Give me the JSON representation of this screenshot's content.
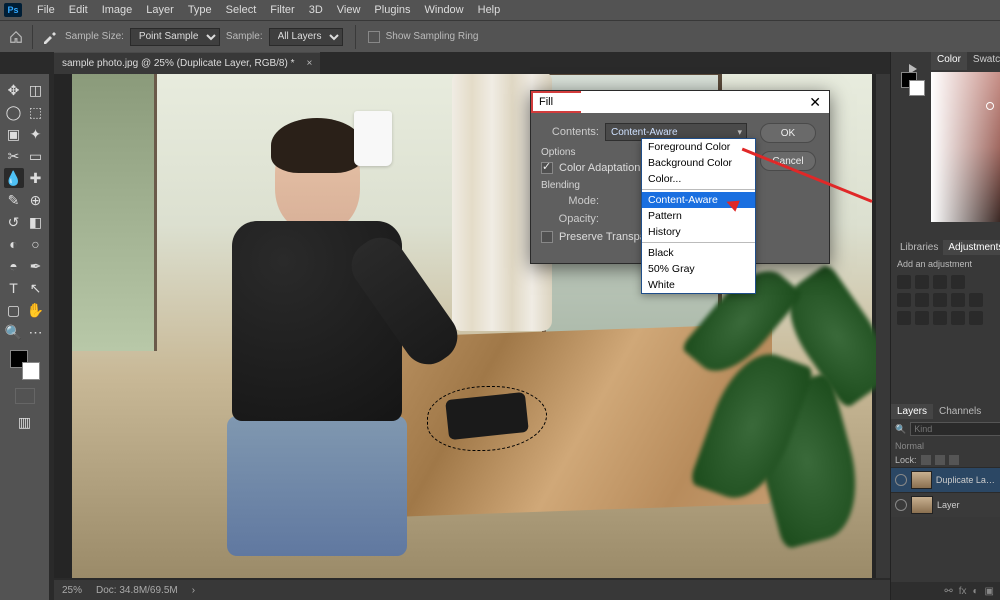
{
  "menu": {
    "items": [
      "File",
      "Edit",
      "Image",
      "Layer",
      "Type",
      "Select",
      "Filter",
      "3D",
      "View",
      "Plugins",
      "Window",
      "Help"
    ]
  },
  "options": {
    "sample_size_label": "Sample Size:",
    "sample_size_value": "Point Sample",
    "sample_label": "Sample:",
    "sample_value": "All Layers",
    "show_ring": "Show Sampling Ring"
  },
  "doc": {
    "tab_title": "sample photo.jpg @ 25% (Duplicate Layer, RGB/8) *",
    "zoom": "25%",
    "docinfo": "Doc: 34.8M/69.5M"
  },
  "fill": {
    "title": "Fill",
    "contents_label": "Contents:",
    "contents_value": "Content-Aware",
    "ok": "OK",
    "cancel": "Cancel",
    "options_header": "Options",
    "color_adapt": "Color Adaptation",
    "blending_header": "Blending",
    "mode_label": "Mode:",
    "opacity_label": "Opacity:",
    "preserve_transparency": "Preserve Transparency",
    "dropdown": {
      "items": [
        "Foreground Color",
        "Background Color",
        "Color...",
        "Content-Aware",
        "Pattern",
        "History",
        "Black",
        "50% Gray",
        "White"
      ],
      "highlighted": "Content-Aware"
    }
  },
  "rightdock": {
    "tabs_color": [
      "Color",
      "Swatches"
    ],
    "tabs_mid": [
      "Libraries",
      "Adjustments"
    ],
    "mid_text": "Add an adjustment",
    "tabs_layers": [
      "Layers",
      "Channels"
    ],
    "kind_placeholder": "Kind",
    "blend_mode": "Normal",
    "lock_label": "Lock:",
    "layers": [
      {
        "name": "Duplicate Layer"
      },
      {
        "name": "Layer"
      }
    ],
    "footer_fx": "fx"
  }
}
